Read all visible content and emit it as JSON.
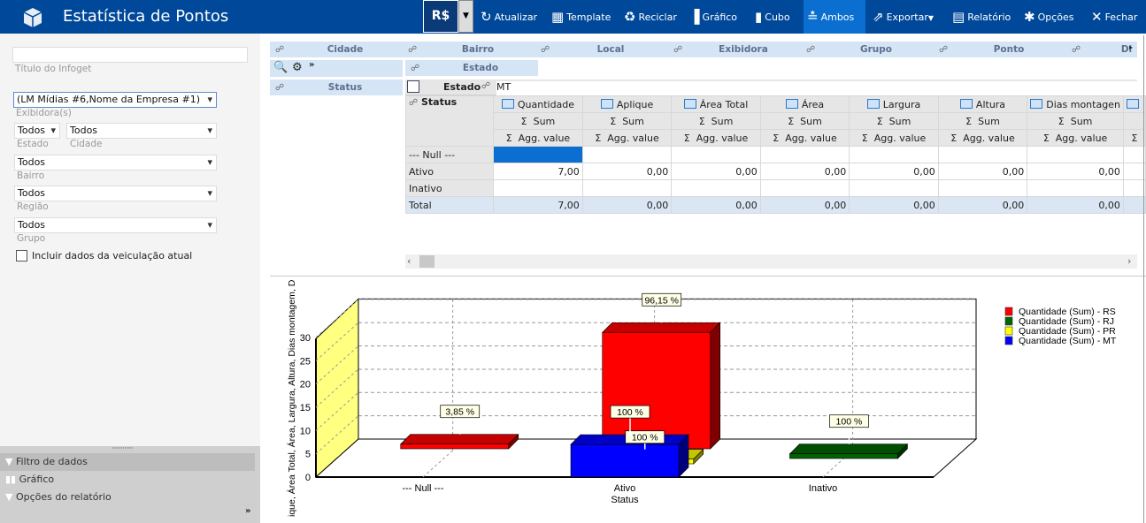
{
  "app": {
    "title": "Estatística de Pontos",
    "currency": "R$"
  },
  "toolbar": [
    {
      "label": "Atualizar",
      "icon": "refresh-icon"
    },
    {
      "label": "Template",
      "icon": "template-icon"
    },
    {
      "label": "Reciclar",
      "icon": "recycle-icon"
    },
    {
      "label": "Gráfico",
      "icon": "bar-chart-icon"
    },
    {
      "label": "Cubo",
      "icon": "cube-icon"
    },
    {
      "label": "Ambos",
      "icon": "both-icon",
      "active": true
    },
    {
      "label": "Exportar",
      "icon": "export-icon"
    },
    {
      "label": "Relatório",
      "icon": "report-icon"
    },
    {
      "label": "Opções",
      "icon": "gear-icon"
    },
    {
      "label": "Fechar",
      "icon": "close-icon"
    }
  ],
  "filters": {
    "title_value": "",
    "title_label": "Título do Infoget",
    "exhibitor_value": "(LM Mídias  #6,Nome da Empresa #1)",
    "exhibitor_label": "Exibidora(s)",
    "estado_value": "Todos",
    "estado_label": "Estado",
    "cidade_value": "Todos",
    "cidade_label": "Cidade",
    "bairro_value": "Todos",
    "bairro_label": "Bairro",
    "regiao_value": "Todos",
    "regiao_label": "Região",
    "grupo_value": "Todos",
    "grupo_label": "Grupo",
    "include_label": "Incluir dados da veiculação atual",
    "include_checked": false
  },
  "accordion": [
    "Filtro de dados",
    "Gráfico",
    "Opções do relatório"
  ],
  "pivot": {
    "filter_fields": [
      "Cidade",
      "Bairro",
      "Local",
      "Exibidora",
      "Grupo",
      "Ponto",
      "Di"
    ],
    "column_field": "Estado",
    "row_field": "Status",
    "col_header_field": "Estado",
    "col_header_value": "MT",
    "row_header": "Status",
    "measures": [
      "Quantidade",
      "Aplique",
      "Área Total",
      "Área",
      "Largura",
      "Altura",
      "Dias montagen"
    ],
    "agg1": "Sum",
    "agg2": "Agg. value",
    "rows": [
      {
        "label": "--- Null ---",
        "values": [
          "",
          "",
          "",
          "",
          "",
          "",
          ""
        ],
        "selected": 0
      },
      {
        "label": "Ativo",
        "values": [
          "7,00",
          "0,00",
          "0,00",
          "0,00",
          "0,00",
          "0,00",
          "0,00"
        ]
      },
      {
        "label": "Inativo",
        "values": [
          "",
          "",
          "",
          "",
          "",
          "",
          ""
        ]
      },
      {
        "label": "Total",
        "values": [
          "7,00",
          "0,00",
          "0,00",
          "0,00",
          "0,00",
          "0,00",
          "0,00"
        ],
        "total": true
      }
    ]
  },
  "chart_data": {
    "type": "bar",
    "categories": [
      "--- Null ---",
      "Ativo",
      "Inativo"
    ],
    "xlabel": "Status",
    "ylabel": "ique, Área Total, Área, Largura, Altura, Dias montagem, Dias",
    "ylim": [
      0,
      30
    ],
    "yticks": [
      0,
      5,
      10,
      15,
      20,
      25,
      30
    ],
    "grid": true,
    "three_d": true,
    "legend_position": "right",
    "series": [
      {
        "name": "Quantidade (Sum) - RS",
        "color": "#ff0000",
        "values": [
          1,
          25,
          null
        ],
        "labels": [
          "3,85 %",
          "96,15 %",
          ""
        ]
      },
      {
        "name": "Quantidade (Sum) - RJ",
        "color": "#006400",
        "values": [
          null,
          null,
          1
        ],
        "labels": [
          "",
          "",
          "100 %"
        ]
      },
      {
        "name": "Quantidade (Sum) - PR",
        "color": "#ffff00",
        "values": [
          null,
          1,
          null
        ],
        "labels": [
          "",
          "100 %",
          ""
        ]
      },
      {
        "name": "Quantidade (Sum) - MT",
        "color": "#0000ff",
        "values": [
          null,
          7,
          null
        ],
        "labels": [
          "",
          "100 %",
          ""
        ]
      }
    ]
  }
}
